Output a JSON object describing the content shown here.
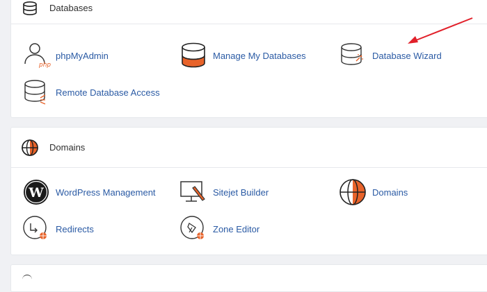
{
  "colors": {
    "link": "#2a5aa4",
    "accent": "#e8632a",
    "arrow": "#e1202a"
  },
  "databases": {
    "title": "Databases",
    "items": [
      {
        "label": "phpMyAdmin",
        "icon": "phpmyadmin-icon"
      },
      {
        "label": "Manage My Databases",
        "icon": "database-orange-icon"
      },
      {
        "label": "Database Wizard",
        "icon": "database-wizard-icon"
      },
      {
        "label": "Remote Database Access",
        "icon": "remote-database-icon"
      }
    ]
  },
  "domains": {
    "title": "Domains",
    "items": [
      {
        "label": "WordPress Management",
        "icon": "wordpress-icon"
      },
      {
        "label": "Sitejet Builder",
        "icon": "sitejet-icon"
      },
      {
        "label": "Domains",
        "icon": "globe-icon"
      },
      {
        "label": "Redirects",
        "icon": "redirect-icon"
      },
      {
        "label": "Zone Editor",
        "icon": "zone-editor-icon"
      }
    ]
  }
}
